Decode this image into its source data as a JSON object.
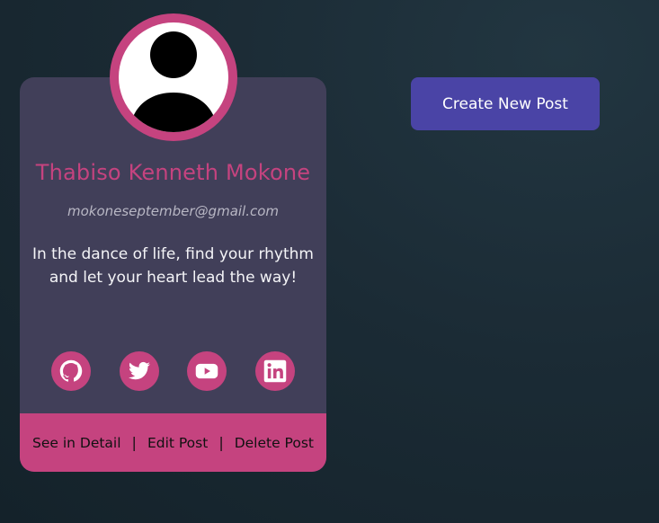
{
  "profile": {
    "name": "Thabiso Kenneth Mokone",
    "email": "mokoneseptember@gmail.com",
    "bio": "In the dance of life, find your rhythm and let your heart lead the way!"
  },
  "socials": [
    {
      "icon": "github-icon"
    },
    {
      "icon": "twitter-icon"
    },
    {
      "icon": "youtube-icon"
    },
    {
      "icon": "linkedin-icon"
    }
  ],
  "actions": {
    "see_detail": "See in Detail",
    "edit": "Edit Post",
    "delete": "Delete Post",
    "separator": "|"
  },
  "create_button": "Create New Post",
  "colors": {
    "accent": "#c5437f",
    "card_bg": "#413f59",
    "button_bg": "#4a44a6",
    "page_bg": "#1b2b35"
  }
}
